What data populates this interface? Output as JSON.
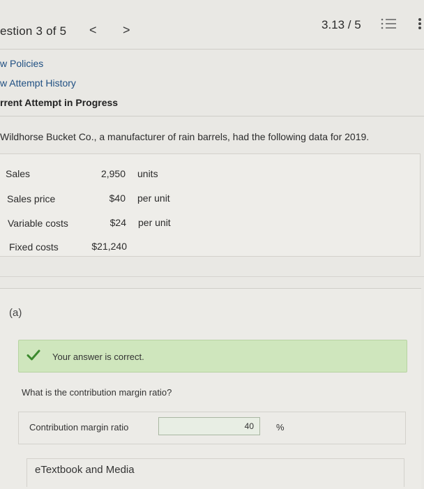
{
  "header": {
    "question_label": "estion 3 of 5",
    "prev_symbol": "<",
    "next_symbol": ">",
    "score": "3.13 / 5",
    "list_icon": "list-icon",
    "more_icon": "more-vertical-icon"
  },
  "nav": {
    "view_policies": "w Policies",
    "view_attempt_history": "w Attempt History",
    "current_attempt": "rrent Attempt in Progress"
  },
  "problem": {
    "text": "Wildhorse Bucket Co., a manufacturer of rain barrels, had the following data for 2019.",
    "rows": [
      {
        "label": "Sales",
        "value": "2,950",
        "unit": "units"
      },
      {
        "label": "Sales price",
        "value": "$40",
        "unit": "per unit"
      },
      {
        "label": "Variable costs",
        "value": "$24",
        "unit": "per unit"
      },
      {
        "label": "Fixed costs",
        "value": "$21,240",
        "unit": ""
      }
    ]
  },
  "part": {
    "label": "(a)",
    "feedback": "Your answer is correct.",
    "question": "What is the contribution margin ratio?",
    "answer_label": "Contribution margin ratio",
    "answer_value": "40",
    "answer_unit": "%",
    "media_label": "eTextbook and Media"
  },
  "colors": {
    "correct_bg": "#cfe6bd",
    "check_green": "#3c8a2e",
    "link_blue": "#1f4f82"
  }
}
